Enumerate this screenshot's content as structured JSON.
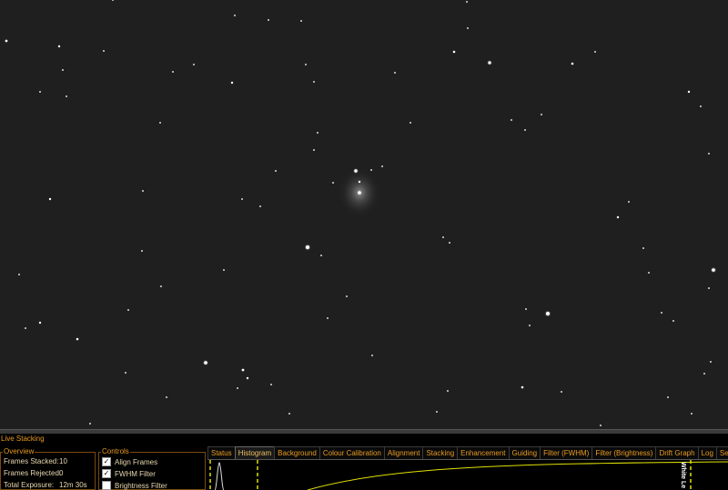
{
  "panel": {
    "title": "Live Stacking"
  },
  "overview": {
    "legend": "Overview",
    "rows": [
      {
        "label": "Frames Stacked:",
        "value": "10"
      },
      {
        "label": "Frames Rejected:",
        "value": "0"
      },
      {
        "label": "Total Exposure:",
        "value": "12m 30s"
      }
    ]
  },
  "controls": {
    "legend": "Controls",
    "items": [
      {
        "label": "Align Frames",
        "checked": true
      },
      {
        "label": "FWHM Filter",
        "checked": true
      },
      {
        "label": "Brightness Filter",
        "checked": false
      }
    ]
  },
  "tabs": [
    {
      "label": "Status",
      "active": false
    },
    {
      "label": "Histogram",
      "active": true
    },
    {
      "label": "Background",
      "active": false
    },
    {
      "label": "Colour Calibration",
      "active": false
    },
    {
      "label": "Alignment",
      "active": false
    },
    {
      "label": "Stacking",
      "active": false
    },
    {
      "label": "Enhancement",
      "active": false
    },
    {
      "label": "Guiding",
      "active": false
    },
    {
      "label": "Filter (FWHM)",
      "active": false
    },
    {
      "label": "Filter (Brightness)",
      "active": false
    },
    {
      "label": "Drift Graph",
      "active": false
    },
    {
      "label": "Log",
      "active": false
    },
    {
      "label": "Setti",
      "active": false
    }
  ],
  "histogram": {
    "white_level_label": "White Le",
    "curve_color": "#e0e000",
    "marker_color": "#e0e000"
  },
  "colors": {
    "accent": "#e89a20",
    "sky": "#1f1f1f"
  }
}
